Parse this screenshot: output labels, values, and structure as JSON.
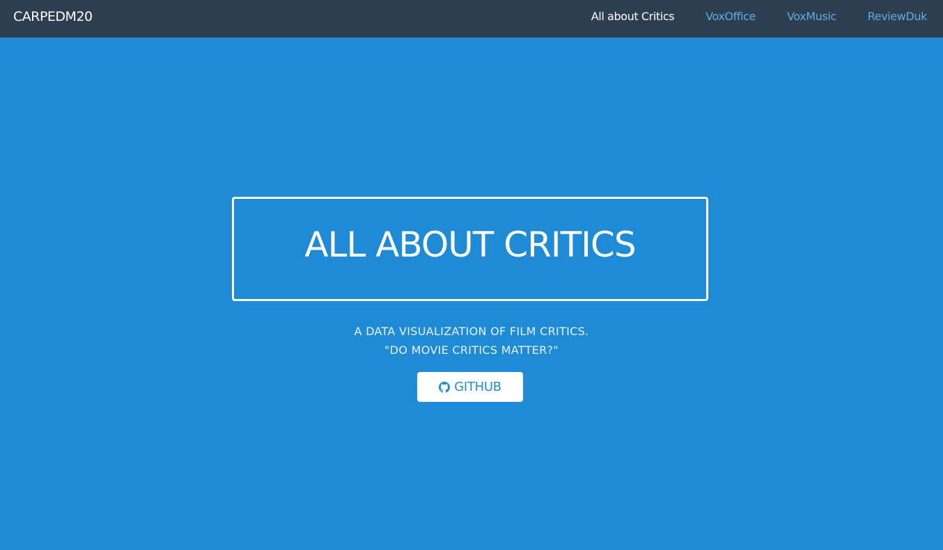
{
  "navbar": {
    "brand": "CARPEDM20",
    "links": [
      {
        "label": "All about Critics",
        "active": true
      },
      {
        "label": "VoxOffice",
        "active": false
      },
      {
        "label": "VoxMusic",
        "active": false
      },
      {
        "label": "ReviewDuk",
        "active": false
      }
    ]
  },
  "hero": {
    "title": "ALL ABOUT CRITICS",
    "subtitle_line1": "A DATA VISUALIZATION OF FILM CRITICS.",
    "subtitle_line2": "\"DO MOVIE CRITICS MATTER?\"",
    "button_label": "GITHUB",
    "button_icon": "github-icon"
  },
  "colors": {
    "background": "#1f8bd6",
    "navbar": "#2c3e50",
    "link": "#5dade2",
    "active_link": "#ffffff"
  }
}
